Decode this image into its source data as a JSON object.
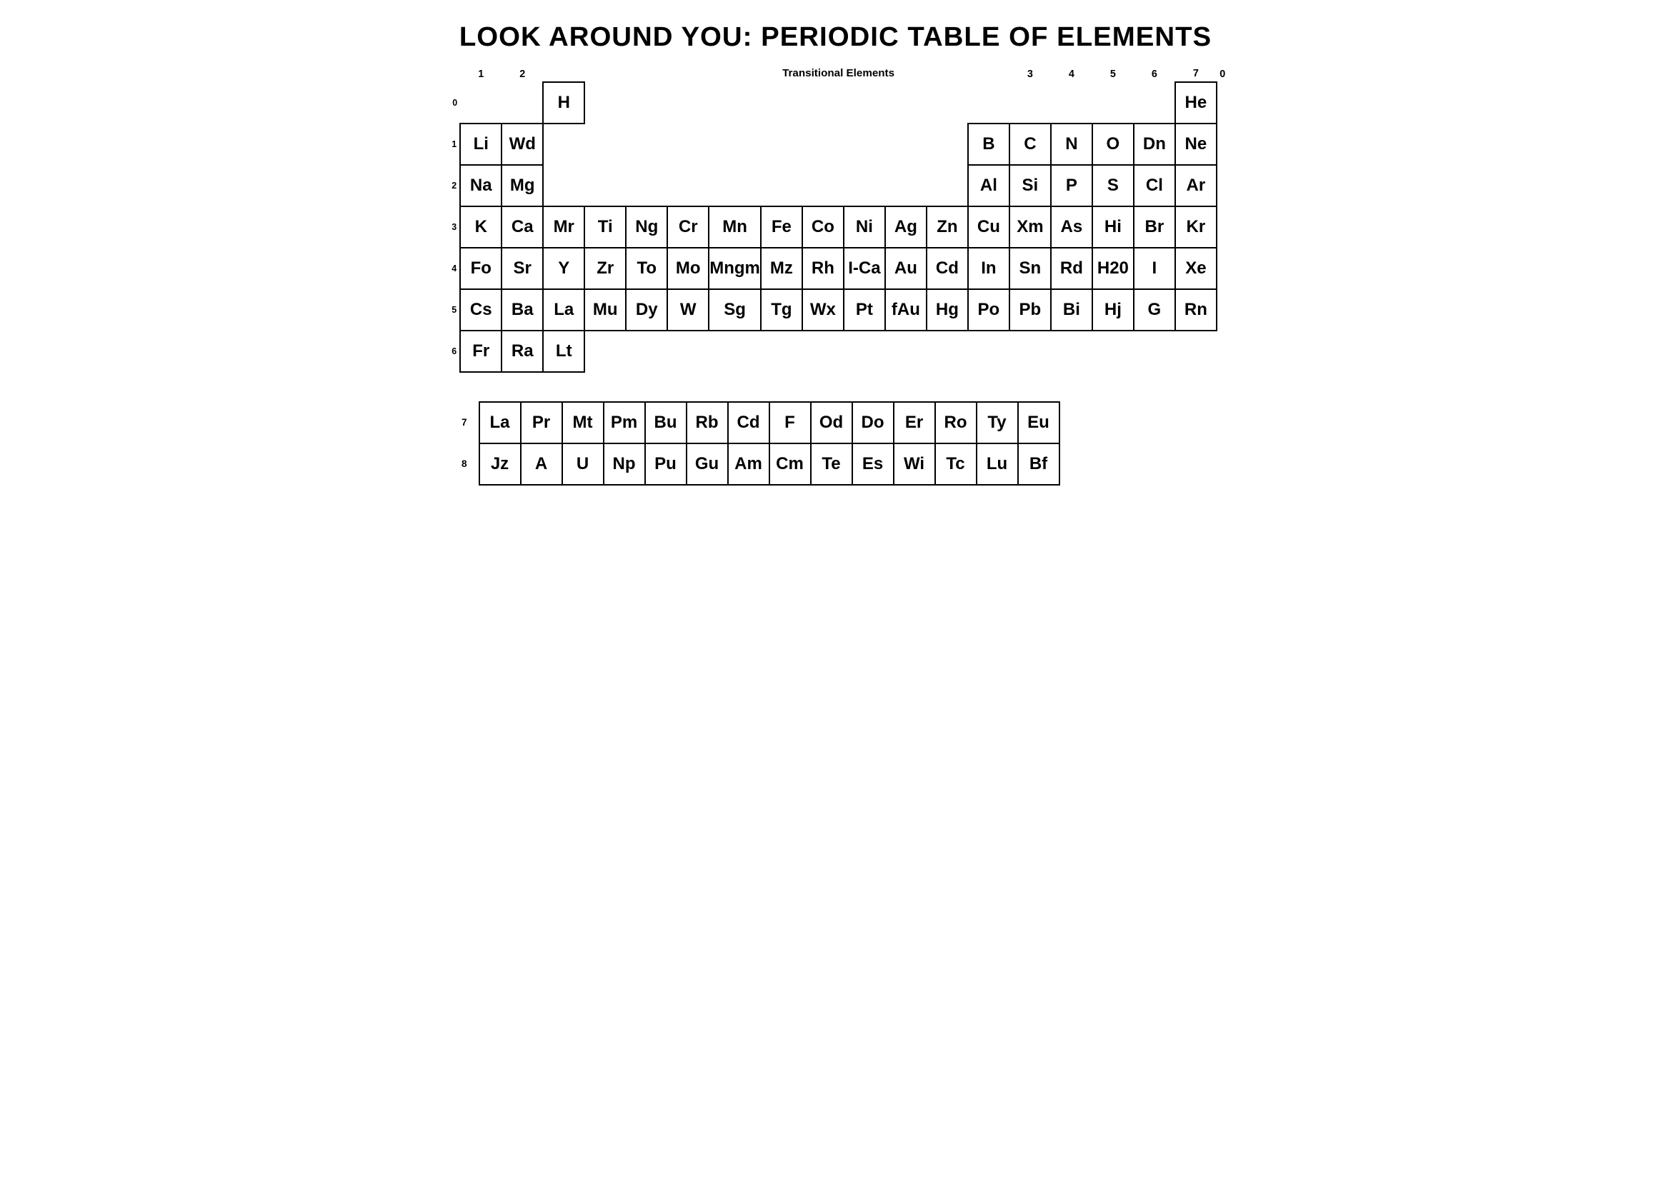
{
  "title": "LOOK AROUND YOU: PERIODIC TABLE OF ELEMENTS",
  "col_headers": [
    "1",
    "2",
    "",
    "",
    "",
    "",
    "Transitional Elements",
    "",
    "",
    "",
    "",
    "",
    "3",
    "4",
    "5",
    "6",
    "7",
    "0"
  ],
  "rows": [
    {
      "label": "0",
      "cells": [
        {
          "symbol": "",
          "col": 1
        },
        {
          "symbol": "",
          "col": 2
        },
        {
          "symbol": "H",
          "col": 3,
          "colspan": 1,
          "special": true
        },
        {
          "symbol": "",
          "col": 4
        },
        {
          "symbol": "",
          "col": 5
        },
        {
          "symbol": "",
          "col": 6
        },
        {
          "symbol": "",
          "col": 7
        },
        {
          "symbol": "",
          "col": 8
        },
        {
          "symbol": "",
          "col": 9
        },
        {
          "symbol": "",
          "col": 10
        },
        {
          "symbol": "",
          "col": 11
        },
        {
          "symbol": "",
          "col": 12
        },
        {
          "symbol": "",
          "col": 13
        },
        {
          "symbol": "",
          "col": 14
        },
        {
          "symbol": "",
          "col": 15
        },
        {
          "symbol": "",
          "col": 16
        },
        {
          "symbol": "",
          "col": 17
        },
        {
          "symbol": "He",
          "col": 18
        }
      ]
    },
    {
      "label": "1",
      "cells": [
        {
          "symbol": "Li"
        },
        {
          "symbol": "Wd"
        },
        {
          "symbol": ""
        },
        {
          "symbol": ""
        },
        {
          "symbol": ""
        },
        {
          "symbol": ""
        },
        {
          "symbol": ""
        },
        {
          "symbol": ""
        },
        {
          "symbol": ""
        },
        {
          "symbol": ""
        },
        {
          "symbol": ""
        },
        {
          "symbol": ""
        },
        {
          "symbol": "B"
        },
        {
          "symbol": "C"
        },
        {
          "symbol": "N"
        },
        {
          "symbol": "O"
        },
        {
          "symbol": "Dn"
        },
        {
          "symbol": "Ne"
        }
      ]
    },
    {
      "label": "2",
      "cells": [
        {
          "symbol": "Na"
        },
        {
          "symbol": "Mg"
        },
        {
          "symbol": ""
        },
        {
          "symbol": ""
        },
        {
          "symbol": ""
        },
        {
          "symbol": ""
        },
        {
          "symbol": ""
        },
        {
          "symbol": ""
        },
        {
          "symbol": ""
        },
        {
          "symbol": ""
        },
        {
          "symbol": ""
        },
        {
          "symbol": ""
        },
        {
          "symbol": "Al"
        },
        {
          "symbol": "Si"
        },
        {
          "symbol": "P"
        },
        {
          "symbol": "S"
        },
        {
          "symbol": "Cl"
        },
        {
          "symbol": "Ar"
        }
      ]
    },
    {
      "label": "3",
      "cells": [
        {
          "symbol": "K"
        },
        {
          "symbol": "Ca"
        },
        {
          "symbol": "Mr"
        },
        {
          "symbol": "Ti"
        },
        {
          "symbol": "Ng"
        },
        {
          "symbol": "Cr"
        },
        {
          "symbol": "Mn"
        },
        {
          "symbol": "Fe"
        },
        {
          "symbol": "Co"
        },
        {
          "symbol": "Ni"
        },
        {
          "symbol": "Ag"
        },
        {
          "symbol": "Zn"
        },
        {
          "symbol": "Cu"
        },
        {
          "symbol": "Xm"
        },
        {
          "symbol": "As"
        },
        {
          "symbol": "Hi"
        },
        {
          "symbol": "Br"
        },
        {
          "symbol": "Kr"
        }
      ]
    },
    {
      "label": "4",
      "cells": [
        {
          "symbol": "Fo"
        },
        {
          "symbol": "Sr"
        },
        {
          "symbol": "Y"
        },
        {
          "symbol": "Zr"
        },
        {
          "symbol": "To"
        },
        {
          "symbol": "Mo"
        },
        {
          "symbol": "Mngm"
        },
        {
          "symbol": "Mz"
        },
        {
          "symbol": "Rh"
        },
        {
          "symbol": "I-Ca"
        },
        {
          "symbol": "Au"
        },
        {
          "symbol": "Cd"
        },
        {
          "symbol": "In"
        },
        {
          "symbol": "Sn"
        },
        {
          "symbol": "Rd"
        },
        {
          "symbol": "H20"
        },
        {
          "symbol": "I"
        },
        {
          "symbol": "Xe"
        }
      ]
    },
    {
      "label": "5",
      "cells": [
        {
          "symbol": "Cs"
        },
        {
          "symbol": "Ba"
        },
        {
          "symbol": "La"
        },
        {
          "symbol": "Mu"
        },
        {
          "symbol": "Dy"
        },
        {
          "symbol": "W"
        },
        {
          "symbol": "Sg"
        },
        {
          "symbol": "Tg"
        },
        {
          "symbol": "Wx"
        },
        {
          "symbol": "Pt"
        },
        {
          "symbol": "fAu"
        },
        {
          "symbol": "Hg"
        },
        {
          "symbol": "Po"
        },
        {
          "symbol": "Pb"
        },
        {
          "symbol": "Bi"
        },
        {
          "symbol": "Hj"
        },
        {
          "symbol": "G"
        },
        {
          "symbol": "Rn"
        }
      ]
    },
    {
      "label": "6",
      "cells": [
        {
          "symbol": "Fr"
        },
        {
          "symbol": "Ra"
        },
        {
          "symbol": "Lt"
        },
        {
          "symbol": ""
        },
        {
          "symbol": ""
        },
        {
          "symbol": ""
        },
        {
          "symbol": ""
        },
        {
          "symbol": ""
        },
        {
          "symbol": ""
        },
        {
          "symbol": ""
        },
        {
          "symbol": ""
        },
        {
          "symbol": ""
        },
        {
          "symbol": ""
        },
        {
          "symbol": ""
        },
        {
          "symbol": ""
        },
        {
          "symbol": ""
        },
        {
          "symbol": ""
        },
        {
          "symbol": ""
        }
      ]
    }
  ],
  "lanthanide_rows": [
    {
      "label": "7",
      "cells": [
        "La",
        "Pr",
        "Mt",
        "Pm",
        "Bu",
        "Rb",
        "Cd",
        "F",
        "Od",
        "Do",
        "Er",
        "Ro",
        "Ty",
        "Eu"
      ]
    },
    {
      "label": "8",
      "cells": [
        "Jz",
        "A",
        "U",
        "Np",
        "Pu",
        "Gu",
        "Am",
        "Cm",
        "Te",
        "Es",
        "Wi",
        "Tc",
        "Lu",
        "Bf"
      ]
    }
  ]
}
